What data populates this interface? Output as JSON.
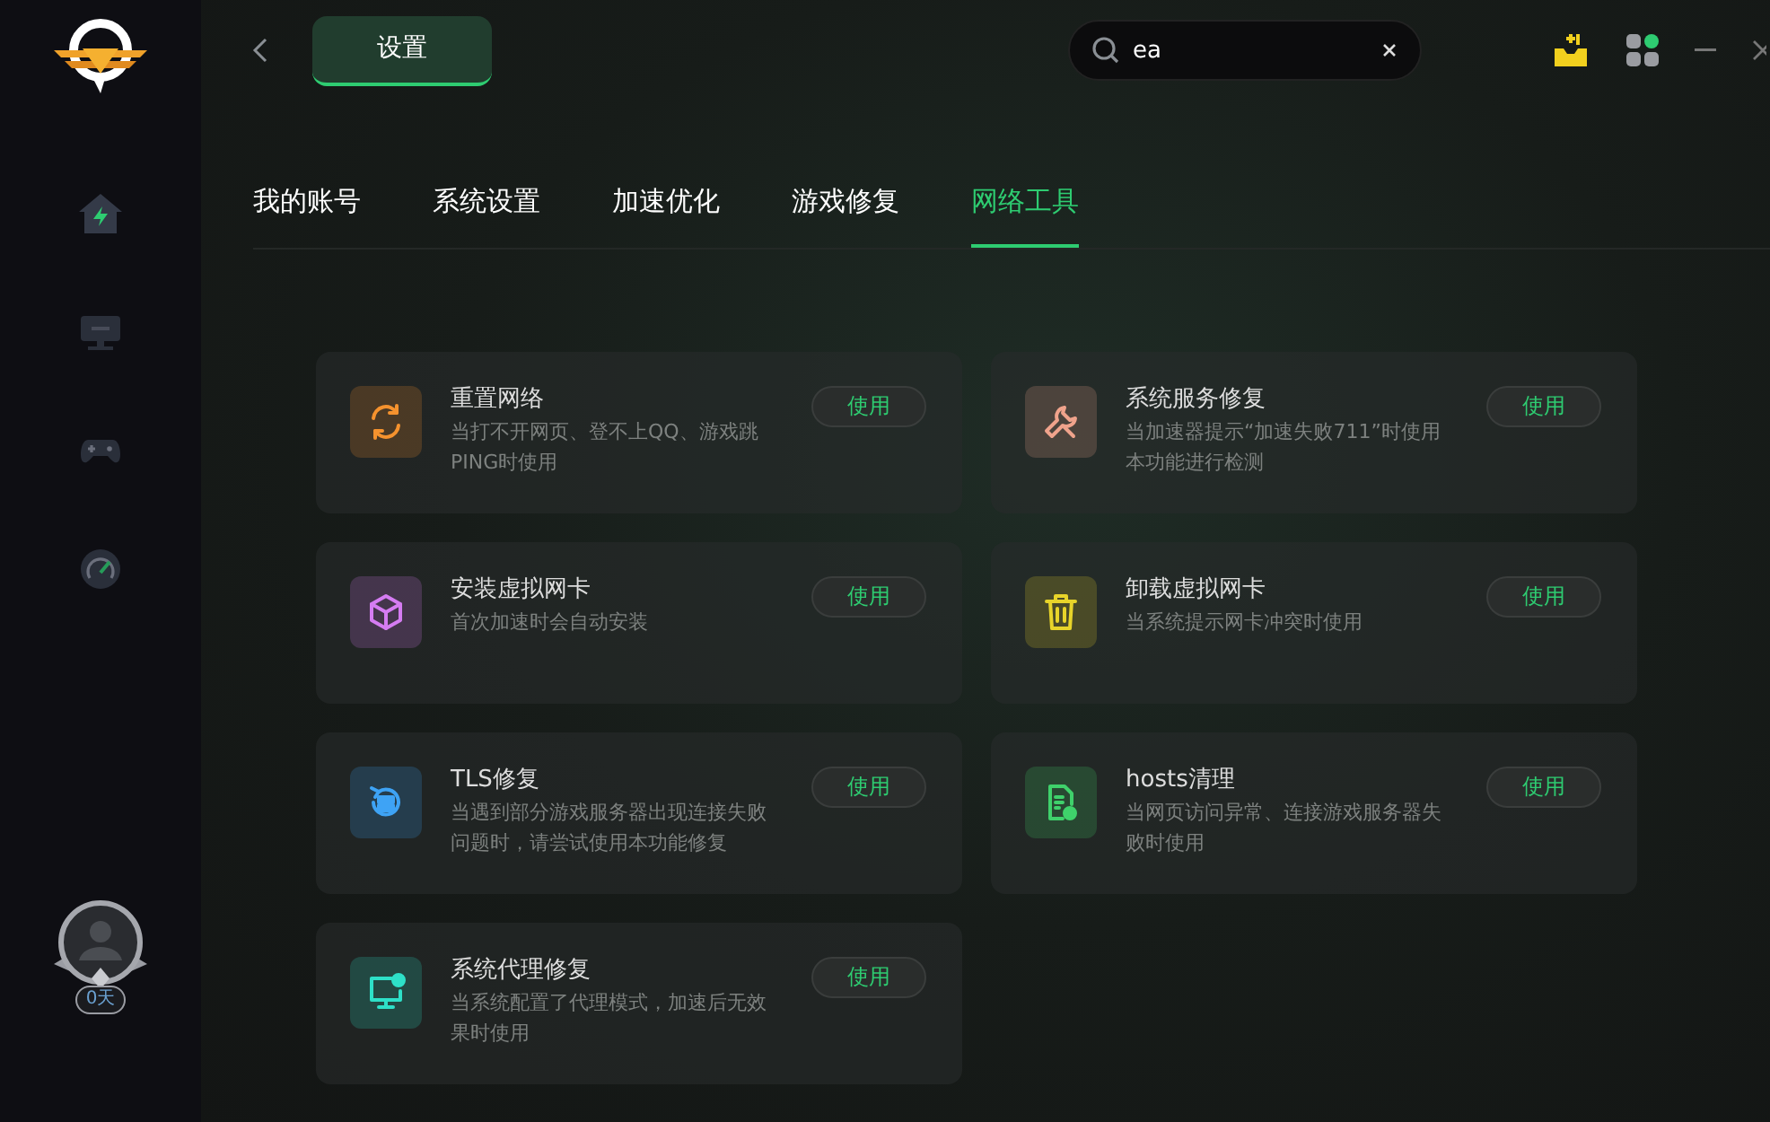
{
  "sidebar": {
    "nav": [
      {
        "kind": "home",
        "selected": true
      },
      {
        "kind": "monitor",
        "selected": false
      },
      {
        "kind": "gamepad",
        "selected": false
      },
      {
        "kind": "gauge",
        "selected": false
      }
    ],
    "badge": "0天"
  },
  "top_tab": {
    "label": "设置",
    "selected": true
  },
  "search": {
    "value": "ea"
  },
  "tabs": [
    {
      "label": "我的账号",
      "selected": false
    },
    {
      "label": "系统设置",
      "selected": false
    },
    {
      "label": "加速优化",
      "selected": false
    },
    {
      "label": "游戏修复",
      "selected": false
    },
    {
      "label": "网络工具",
      "selected": true
    }
  ],
  "tools": [
    {
      "kind": "refresh",
      "color": "#f5922e",
      "title": "重置网络",
      "description": "当打不开网页、登不上QQ、游戏跳PING时使用",
      "button": "使用"
    },
    {
      "kind": "wrench",
      "color": "#f0a38c",
      "title": "系统服务修复",
      "description": "当加速器提示“加速失败711”时使用本功能进行检测",
      "button": "使用"
    },
    {
      "kind": "cube",
      "color": "#d57cf2",
      "title": "安装虚拟网卡",
      "description": "首次加速时会自动安装",
      "button": "使用"
    },
    {
      "kind": "trash",
      "color": "#e8d42a",
      "title": "卸载虚拟网卡",
      "description": "当系统提示网卡冲突时使用",
      "button": "使用"
    },
    {
      "kind": "server",
      "color": "#3ea3f5",
      "title": "TLS修复",
      "description": "当遇到部分游戏服务器出现连接失败问题时，请尝试使用本功能修复",
      "button": "使用"
    },
    {
      "kind": "file",
      "color": "#3fd16b",
      "title": "hosts清理",
      "description": "当网页访问异常、连接游戏服务器失败时使用",
      "button": "使用"
    },
    {
      "kind": "monitor",
      "color": "#2ee0c8",
      "title": "系统代理修复",
      "description": "当系统配置了代理模式，加速后无效果时使用",
      "button": "使用"
    }
  ]
}
